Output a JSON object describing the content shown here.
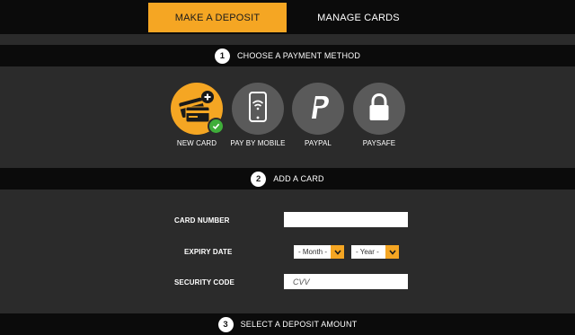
{
  "tabs": {
    "make_deposit": "MAKE A DEPOSIT",
    "manage_cards": "MANAGE CARDS"
  },
  "steps": [
    {
      "number": "1",
      "title": "CHOOSE A PAYMENT METHOD"
    },
    {
      "number": "2",
      "title": "ADD A CARD"
    },
    {
      "number": "3",
      "title": "SELECT A DEPOSIT AMOUNT"
    }
  ],
  "payment_methods": [
    {
      "label": "NEW CARD",
      "icon": "credit-card-add-icon",
      "selected": true
    },
    {
      "label": "PAY BY MOBILE",
      "icon": "mobile-phone-wifi-icon",
      "selected": false
    },
    {
      "label": "PAYPAL",
      "icon": "paypal-icon",
      "selected": false
    },
    {
      "label": "PAYSAFE",
      "icon": "padlock-icon",
      "selected": false
    }
  ],
  "card_form": {
    "card_number_label": "CARD NUMBER",
    "card_number_value": "",
    "expiry_label": "EXPIRY DATE",
    "month_value": "- Month -",
    "year_value": "- Year -",
    "security_label": "SECURITY CODE",
    "security_placeholder": "CVV"
  },
  "colors": {
    "accent": "#f5a623",
    "bar": "#0b0b0b",
    "panel": "#2b2b2b",
    "icon_bg": "#5a5a5a",
    "check": "#3fae3a"
  }
}
